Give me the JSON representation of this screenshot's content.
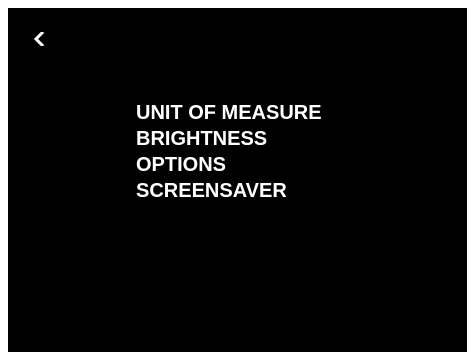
{
  "header": {
    "back_icon": "chevron-left-icon"
  },
  "menu": {
    "items": [
      {
        "label": "UNIT OF MEASURE"
      },
      {
        "label": "BRIGHTNESS"
      },
      {
        "label": "OPTIONS"
      },
      {
        "label": "SCREENSAVER"
      }
    ]
  },
  "colors": {
    "background": "#000000",
    "text": "#ffffff"
  }
}
